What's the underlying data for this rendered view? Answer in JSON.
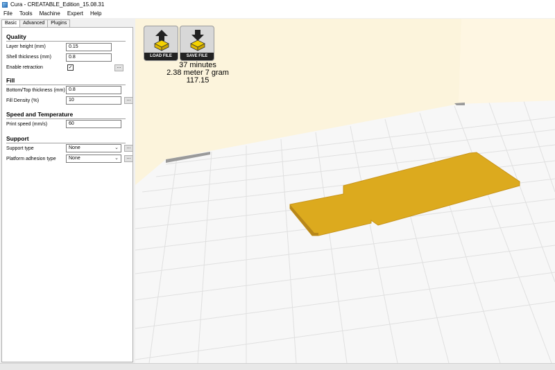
{
  "window": {
    "title": "Cura - CREATABLE_Edition_15.08.31"
  },
  "menu": [
    "File",
    "Tools",
    "Machine",
    "Expert",
    "Help"
  ],
  "tabs": [
    "Basic",
    "Advanced",
    "Plugins"
  ],
  "sections": {
    "quality": "Quality",
    "fill": "Fill",
    "speed": "Speed and Temperature",
    "support": "Support"
  },
  "fields": {
    "layer_height": {
      "label": "Layer height (mm)",
      "value": "0.15"
    },
    "shell_thickness": {
      "label": "Shell thickness (mm)",
      "value": "0.8"
    },
    "enable_retraction": {
      "label": "Enable retraction",
      "checked": true
    },
    "bottom_top_thickness": {
      "label": "Bottom/Top thickness (mm)",
      "value": "0.8"
    },
    "fill_density": {
      "label": "Fill Density (%)",
      "value": "10"
    },
    "print_speed": {
      "label": "Print speed (mm/s)",
      "value": "60"
    },
    "support_type": {
      "label": "Support type",
      "value": "None"
    },
    "platform_adhesion": {
      "label": "Platform adhesion type",
      "value": "None"
    }
  },
  "more_button": "...",
  "checkbox_mark": "✓",
  "toolbar": {
    "load_file": "LOAD FILE",
    "save_file": "SAVE FILE"
  },
  "stats": {
    "time": "37 minutes",
    "material": "2.38 meter 7 gram",
    "cost": "117.15"
  },
  "colors": {
    "model": "#dcaa1e",
    "floor": "#f7f7f7",
    "wall": "#fcf4dc",
    "grid": "#e2e2e2"
  }
}
